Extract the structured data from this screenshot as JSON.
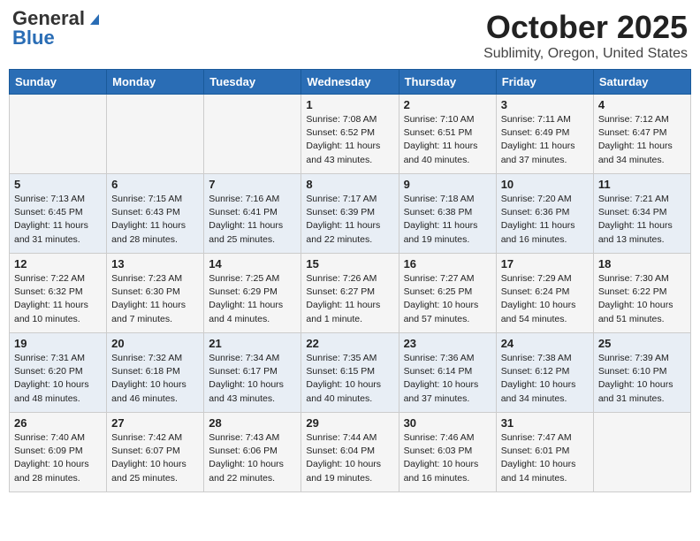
{
  "logo": {
    "general": "General",
    "blue": "Blue"
  },
  "title": "October 2025",
  "subtitle": "Sublimity, Oregon, United States",
  "days_of_week": [
    "Sunday",
    "Monday",
    "Tuesday",
    "Wednesday",
    "Thursday",
    "Friday",
    "Saturday"
  ],
  "weeks": [
    [
      {
        "day": null,
        "info": null
      },
      {
        "day": null,
        "info": null
      },
      {
        "day": null,
        "info": null
      },
      {
        "day": "1",
        "sunrise": "7:08 AM",
        "sunset": "6:52 PM",
        "daylight": "11 hours and 43 minutes."
      },
      {
        "day": "2",
        "sunrise": "7:10 AM",
        "sunset": "6:51 PM",
        "daylight": "11 hours and 40 minutes."
      },
      {
        "day": "3",
        "sunrise": "7:11 AM",
        "sunset": "6:49 PM",
        "daylight": "11 hours and 37 minutes."
      },
      {
        "day": "4",
        "sunrise": "7:12 AM",
        "sunset": "6:47 PM",
        "daylight": "11 hours and 34 minutes."
      }
    ],
    [
      {
        "day": "5",
        "sunrise": "7:13 AM",
        "sunset": "6:45 PM",
        "daylight": "11 hours and 31 minutes."
      },
      {
        "day": "6",
        "sunrise": "7:15 AM",
        "sunset": "6:43 PM",
        "daylight": "11 hours and 28 minutes."
      },
      {
        "day": "7",
        "sunrise": "7:16 AM",
        "sunset": "6:41 PM",
        "daylight": "11 hours and 25 minutes."
      },
      {
        "day": "8",
        "sunrise": "7:17 AM",
        "sunset": "6:39 PM",
        "daylight": "11 hours and 22 minutes."
      },
      {
        "day": "9",
        "sunrise": "7:18 AM",
        "sunset": "6:38 PM",
        "daylight": "11 hours and 19 minutes."
      },
      {
        "day": "10",
        "sunrise": "7:20 AM",
        "sunset": "6:36 PM",
        "daylight": "11 hours and 16 minutes."
      },
      {
        "day": "11",
        "sunrise": "7:21 AM",
        "sunset": "6:34 PM",
        "daylight": "11 hours and 13 minutes."
      }
    ],
    [
      {
        "day": "12",
        "sunrise": "7:22 AM",
        "sunset": "6:32 PM",
        "daylight": "11 hours and 10 minutes."
      },
      {
        "day": "13",
        "sunrise": "7:23 AM",
        "sunset": "6:30 PM",
        "daylight": "11 hours and 7 minutes."
      },
      {
        "day": "14",
        "sunrise": "7:25 AM",
        "sunset": "6:29 PM",
        "daylight": "11 hours and 4 minutes."
      },
      {
        "day": "15",
        "sunrise": "7:26 AM",
        "sunset": "6:27 PM",
        "daylight": "11 hours and 1 minute."
      },
      {
        "day": "16",
        "sunrise": "7:27 AM",
        "sunset": "6:25 PM",
        "daylight": "10 hours and 57 minutes."
      },
      {
        "day": "17",
        "sunrise": "7:29 AM",
        "sunset": "6:24 PM",
        "daylight": "10 hours and 54 minutes."
      },
      {
        "day": "18",
        "sunrise": "7:30 AM",
        "sunset": "6:22 PM",
        "daylight": "10 hours and 51 minutes."
      }
    ],
    [
      {
        "day": "19",
        "sunrise": "7:31 AM",
        "sunset": "6:20 PM",
        "daylight": "10 hours and 48 minutes."
      },
      {
        "day": "20",
        "sunrise": "7:32 AM",
        "sunset": "6:18 PM",
        "daylight": "10 hours and 46 minutes."
      },
      {
        "day": "21",
        "sunrise": "7:34 AM",
        "sunset": "6:17 PM",
        "daylight": "10 hours and 43 minutes."
      },
      {
        "day": "22",
        "sunrise": "7:35 AM",
        "sunset": "6:15 PM",
        "daylight": "10 hours and 40 minutes."
      },
      {
        "day": "23",
        "sunrise": "7:36 AM",
        "sunset": "6:14 PM",
        "daylight": "10 hours and 37 minutes."
      },
      {
        "day": "24",
        "sunrise": "7:38 AM",
        "sunset": "6:12 PM",
        "daylight": "10 hours and 34 minutes."
      },
      {
        "day": "25",
        "sunrise": "7:39 AM",
        "sunset": "6:10 PM",
        "daylight": "10 hours and 31 minutes."
      }
    ],
    [
      {
        "day": "26",
        "sunrise": "7:40 AM",
        "sunset": "6:09 PM",
        "daylight": "10 hours and 28 minutes."
      },
      {
        "day": "27",
        "sunrise": "7:42 AM",
        "sunset": "6:07 PM",
        "daylight": "10 hours and 25 minutes."
      },
      {
        "day": "28",
        "sunrise": "7:43 AM",
        "sunset": "6:06 PM",
        "daylight": "10 hours and 22 minutes."
      },
      {
        "day": "29",
        "sunrise": "7:44 AM",
        "sunset": "6:04 PM",
        "daylight": "10 hours and 19 minutes."
      },
      {
        "day": "30",
        "sunrise": "7:46 AM",
        "sunset": "6:03 PM",
        "daylight": "10 hours and 16 minutes."
      },
      {
        "day": "31",
        "sunrise": "7:47 AM",
        "sunset": "6:01 PM",
        "daylight": "10 hours and 14 minutes."
      },
      {
        "day": null,
        "info": null
      }
    ]
  ]
}
